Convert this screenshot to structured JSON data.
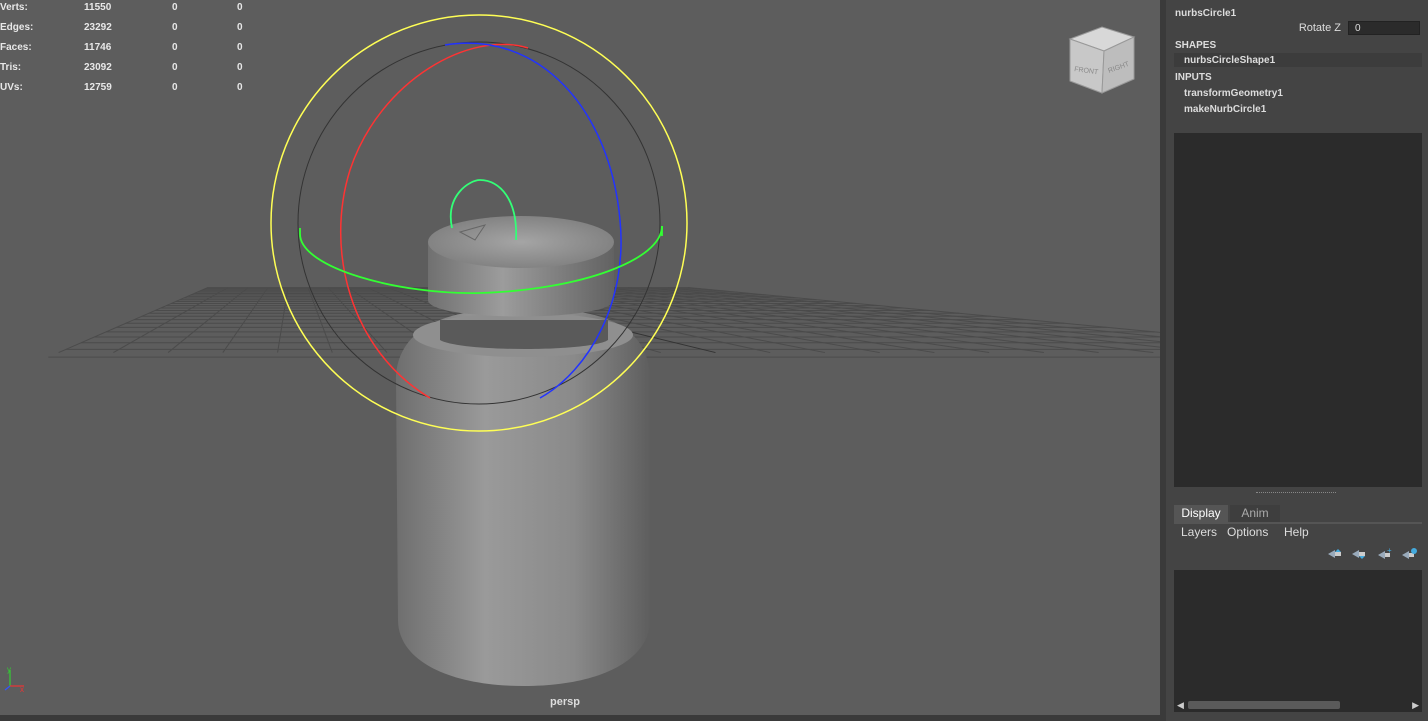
{
  "hud": {
    "rows": [
      {
        "label": "Verts:",
        "v1": "11550",
        "v2": "0",
        "v3": "0"
      },
      {
        "label": "Edges:",
        "v1": "23292",
        "v2": "0",
        "v3": "0"
      },
      {
        "label": "Faces:",
        "v1": "11746",
        "v2": "0",
        "v3": "0"
      },
      {
        "label": "Tris:",
        "v1": "23092",
        "v2": "0",
        "v3": "0"
      },
      {
        "label": "UVs:",
        "v1": "12759",
        "v2": "0",
        "v3": "0"
      }
    ]
  },
  "viewport": {
    "camera_label": "persp",
    "viewcube_front": "FRONT",
    "viewcube_right": "RIGHT",
    "axis_x": "x",
    "axis_y": "y",
    "colors": {
      "background": "#5d5d5d",
      "grid": "#4a4a4a",
      "grid_major": "#3a3a3a",
      "rotate_outer": "#ffff55",
      "rotate_x": "#ff2222",
      "rotate_y": "#22ff22",
      "rotate_z": "#2222ff"
    }
  },
  "channel_box": {
    "node_name": "nurbsCircle1",
    "rotate_z_label": "Rotate Z",
    "rotate_z_value": "0",
    "shapes_header": "SHAPES",
    "shape_item": "nurbsCircleShape1",
    "inputs_header": "INPUTS",
    "inputs": [
      "transformGeometry1",
      "makeNurbCircle1"
    ]
  },
  "layer_editor": {
    "tabs": [
      "Display",
      "Anim"
    ],
    "active_tab": "Display",
    "menus": [
      "Layers",
      "Options",
      "Help"
    ],
    "buttons": [
      {
        "icon": "move-layer-up-icon"
      },
      {
        "icon": "move-layer-down-icon"
      },
      {
        "icon": "new-layer-icon"
      },
      {
        "icon": "new-layer-selected-icon"
      }
    ]
  }
}
